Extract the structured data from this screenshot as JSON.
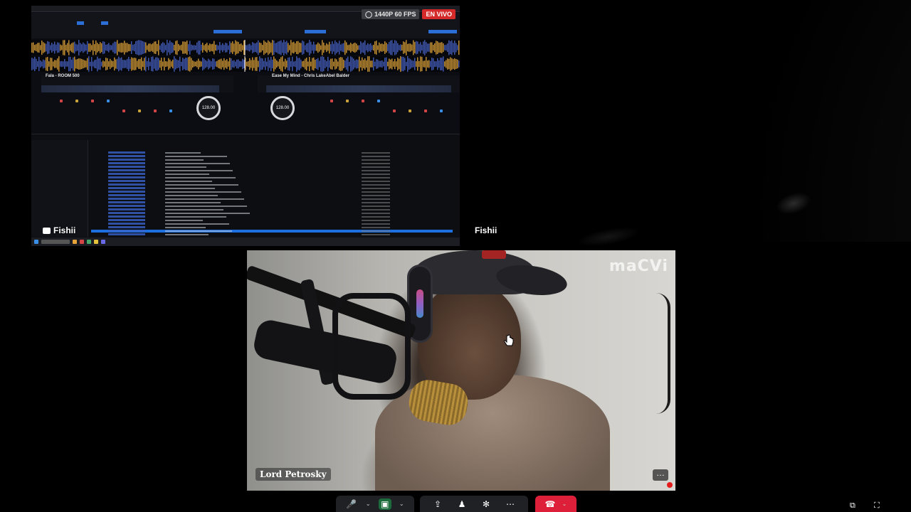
{
  "share": {
    "presenter_name": "Fishii",
    "stream_resolution": "1440P 60 FPS",
    "live_label": "EN VIVO",
    "deck_a": {
      "title": "Fala - ROOM 500",
      "bpm": "128.00"
    },
    "deck_b": {
      "title": "Ease My Mind - Chris LakeAbel Balder",
      "bpm": "128.00"
    },
    "colors": {
      "accent": "#2b6fd6",
      "waveform_orange": "#e0a33a",
      "waveform_blue": "#4a63c8",
      "selected_row": "#1d6fe0"
    }
  },
  "participant_tile": {
    "name": "Fishii"
  },
  "camera_tile": {
    "name": "Lord Petrosky",
    "watermark": "maCVi"
  },
  "controls": {
    "mic_icon": "microphone-icon",
    "camera_icon": "video-camera-icon",
    "share_icon": "share-screen-icon",
    "people_icon": "people-icon",
    "effects_icon": "effects-icon",
    "more_icon": "more-icon",
    "leave_icon": "phone-hangup-icon",
    "leave_color": "#dd1f3a"
  }
}
